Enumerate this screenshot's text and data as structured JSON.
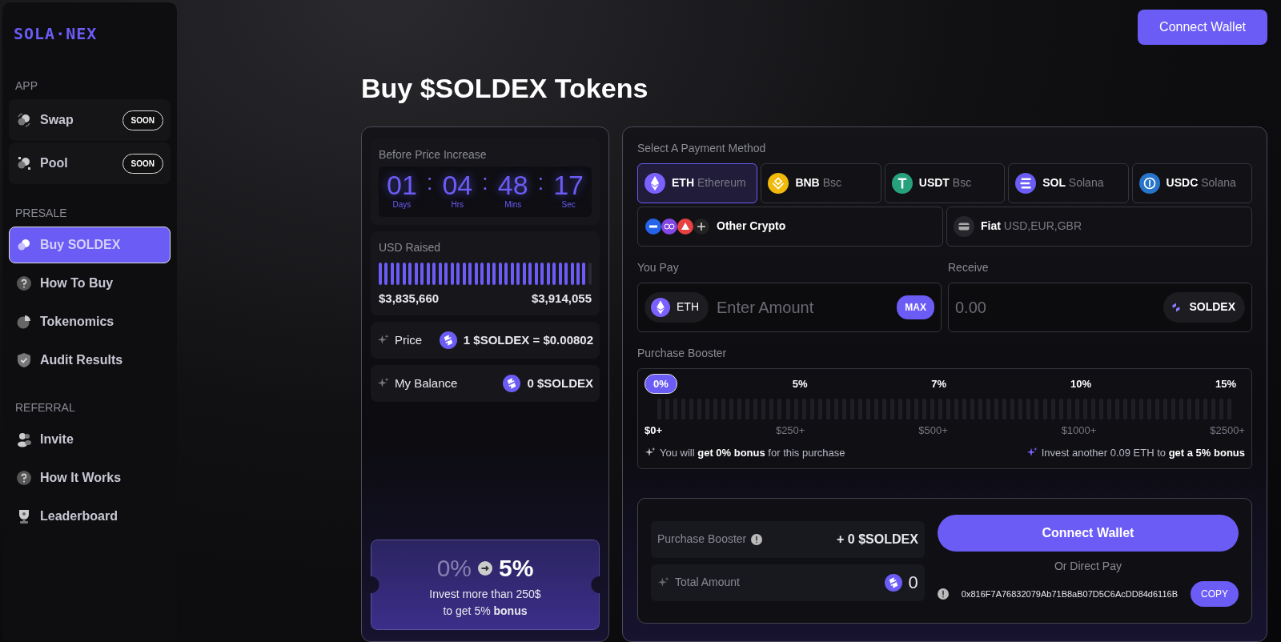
{
  "logo": "SOLA·NEX",
  "header": {
    "connect_button": "Connect Wallet"
  },
  "sidebar": {
    "sections": [
      {
        "title": "APP",
        "items": [
          {
            "label": "Swap",
            "badge": "SOON",
            "selected": false
          },
          {
            "label": "Pool",
            "badge": "SOON",
            "selected": false
          }
        ]
      },
      {
        "title": "PRESALE",
        "items": [
          {
            "label": "Buy SOLDEX",
            "selected": true
          },
          {
            "label": "How To Buy",
            "selected": false
          },
          {
            "label": "Tokenomics",
            "selected": false
          },
          {
            "label": "Audit Results",
            "selected": false
          }
        ]
      },
      {
        "title": "REFERRAL",
        "items": [
          {
            "label": "Invite",
            "selected": false
          },
          {
            "label": "How It Works",
            "selected": false
          },
          {
            "label": "Leaderboard",
            "selected": false
          }
        ]
      }
    ]
  },
  "page_title": "Buy $SOLDEX Tokens",
  "countdown": {
    "title": "Before Price Increase",
    "separator": ":",
    "units": [
      {
        "value": "01",
        "label": "Days"
      },
      {
        "value": "04",
        "label": "Hrs"
      },
      {
        "value": "48",
        "label": "Mins"
      },
      {
        "value": "17",
        "label": "Sec"
      }
    ]
  },
  "raised": {
    "title": "USD Raised",
    "level": 0.97,
    "raised": "$3,835,660",
    "goal": "$3,914,055"
  },
  "stats": [
    {
      "label": "Price",
      "value": "1 $SOLDEX = $0.00802"
    },
    {
      "label": "My Balance",
      "value": "0 $SOLDEX"
    }
  ],
  "bonus_ticket": {
    "from": "0%",
    "to": "5%",
    "line1": "Invest more than 250$",
    "line2": "to get 5% **bonus**"
  },
  "payment": {
    "title": "Select A Payment Method",
    "methods": [
      {
        "kind": "coin",
        "symbol": "ETH",
        "network": "Ethereum",
        "color": "#7b61ff",
        "selected": true
      },
      {
        "kind": "coin",
        "symbol": "BNB",
        "network": "Bsc",
        "color": "#f0b90b",
        "selected": false
      },
      {
        "kind": "coin",
        "symbol": "USDT",
        "network": "Bsc",
        "color": "#26a17b",
        "selected": false
      },
      {
        "kind": "coin",
        "symbol": "SOL",
        "network": "Solana",
        "color": "#6b5cf6",
        "selected": false
      },
      {
        "kind": "coin",
        "symbol": "USDC",
        "network": "Solana",
        "color": "#2775ca",
        "selected": false
      },
      {
        "kind": "others",
        "symbol": "Other Crypto",
        "selected": false
      },
      {
        "kind": "fiat",
        "symbol": "Fiat",
        "network": "USD,EUR,GBR",
        "selected": false
      }
    ]
  },
  "pay": {
    "label": "You Pay",
    "token": "ETH",
    "placeholder": "Enter Amount",
    "max": "MAX"
  },
  "receive": {
    "label": "Receive",
    "amount": "0.00",
    "token": "SOLDEX"
  },
  "booster": {
    "title": "Purchase Booster",
    "tiers": [
      {
        "percent": "0%",
        "amount": "$0+",
        "selected": true
      },
      {
        "percent": "5%",
        "amount": "$250+",
        "selected": false
      },
      {
        "percent": "7%",
        "amount": "$500+",
        "selected": false
      },
      {
        "percent": "10%",
        "amount": "$1000+",
        "selected": false
      },
      {
        "percent": "15%",
        "amount": "$2500+",
        "selected": false
      }
    ],
    "note_left": "You will **get 0% bonus** for this purchase",
    "note_right": "Invest another 0.09 ETH to **get a 5% bonus**"
  },
  "summary": {
    "booster_label": "Purchase Booster",
    "booster_value": "+ 0 $SOLDEX",
    "total_label": "Total Amount",
    "total_value": "0",
    "connect_button": "Connect Wallet",
    "or_text": "Or Direct Pay",
    "address": "0x816F7A76832079Ab71B8aB07D5C6AcDD84d6116B",
    "copy_button": "COPY"
  }
}
